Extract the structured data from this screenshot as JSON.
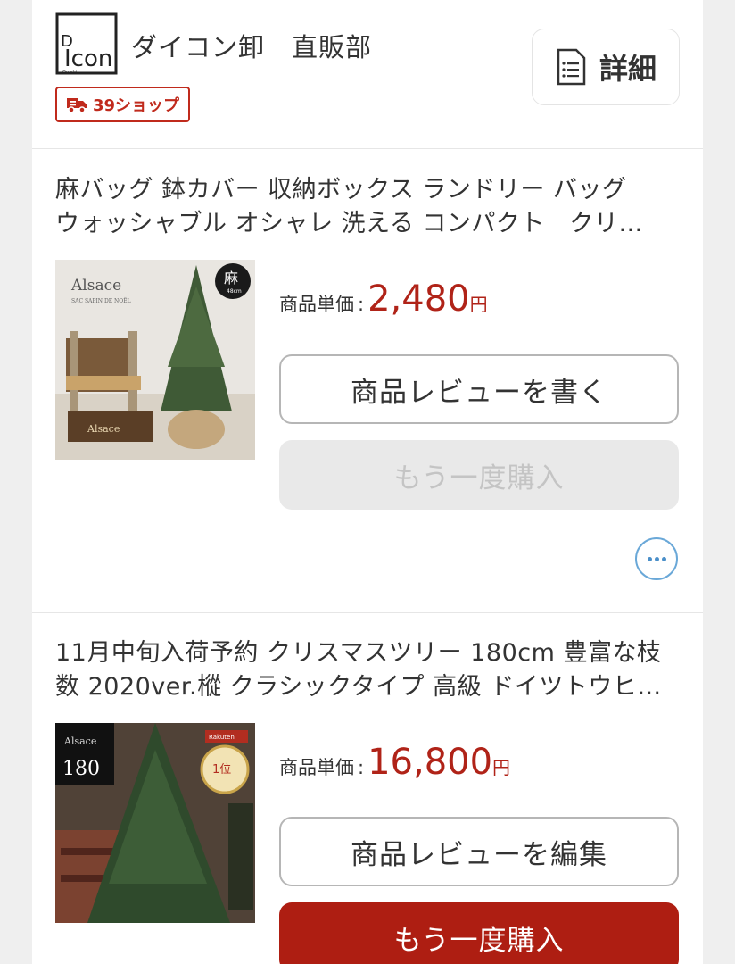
{
  "shop": {
    "name": "ダイコン卸　直販部",
    "badge_label": "39ショップ",
    "detail_label": "詳細",
    "logo_text": "DIcon Oroshi"
  },
  "items": [
    {
      "title_line1": "麻バッグ 鉢カバー 収納ボックス ランドリー バッグ",
      "title_line2": "ウォッシャブル オシャレ 洗える コンパクト　クリ…",
      "price_label": "商品単価",
      "price_colon": ":",
      "price_value": "2,480",
      "price_unit": "円",
      "review_button": "商品レビューを書く",
      "rebuy_button": "もう一度購入",
      "rebuy_enabled": false,
      "image_text": {
        "brand": "Alsace",
        "sub": "SAC SAPIN DE NOËL",
        "badge": "麻",
        "badge_sub": "48cm",
        "box_label": "Alsace"
      }
    },
    {
      "title_line1": "11月中旬入荷予約 クリスマスツリー 180cm 豊富な枝",
      "title_line2": "数 2020ver.樅 クラシックタイプ 高級 ドイツトウヒ…",
      "price_label": "商品単価",
      "price_colon": ":",
      "price_value": "16,800",
      "price_unit": "円",
      "review_button": "商品レビューを編集",
      "rebuy_button": "もう一度購入",
      "rebuy_enabled": true,
      "image_text": {
        "brand": "Alsace",
        "size": "180",
        "rank": "1位",
        "ribbon": "Rakuten"
      }
    }
  ],
  "colors": {
    "price": "#b02318",
    "primary_button": "#ae1e12",
    "badge": "#c02a1c",
    "more_icon": "#4a8fc9"
  }
}
